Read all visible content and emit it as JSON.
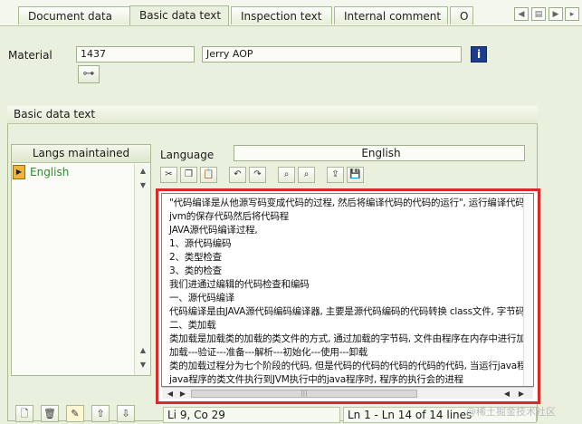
{
  "tabs": [
    "Document data",
    "Basic data text",
    "Inspection text",
    "Internal comment",
    "O"
  ],
  "active_tab": "Basic data text",
  "material": {
    "label": "Material",
    "number": "1437",
    "description": "Jerry AOP"
  },
  "group_title": "Basic data text",
  "langs": {
    "header": "Langs maintained",
    "items": [
      "English"
    ]
  },
  "language": {
    "label": "Language",
    "value": "English"
  },
  "editor_lines": [
    "\"代码编译是从他源写码变成代码的过程, 然后将编译代码的代码的运行\", 运行编译代码的执行在",
    "jvm的保存代码然后将代码程",
    "JAVA源代码编译过程,",
    "1、源代码编码",
    "2、类型检查",
    "3、类的检查",
    "我们进通过编辑的代码检查和编码",
    "一、源代码编译",
    "代码编译是由JAVA源代码编码编译器, 主要是源代码编码的代码转换 class文件, 字节码的代码转换",
    "二、类加载",
    "类加载是加载类的加载的类文件的方式, 通过加载的字节码, 文件由程序在内存中进行加载, 其中进行字节码检查的检查",
    "加载---验证---准备---解析---初始化---使用---卸载",
    "类的加载过程分为七个阶段的代码, 但是代码的代码的代码的代码的代码, 当运行java程序时, 会启动一个进程",
    "java程序的类文件执行到JVM执行中的java程序时, 程序的执行会的进程"
  ],
  "status": {
    "position": "Li 9, Co 29",
    "range": "Ln 1 - Ln 14 of 14 lines"
  },
  "watermark": "@稀土掘金技术社区"
}
